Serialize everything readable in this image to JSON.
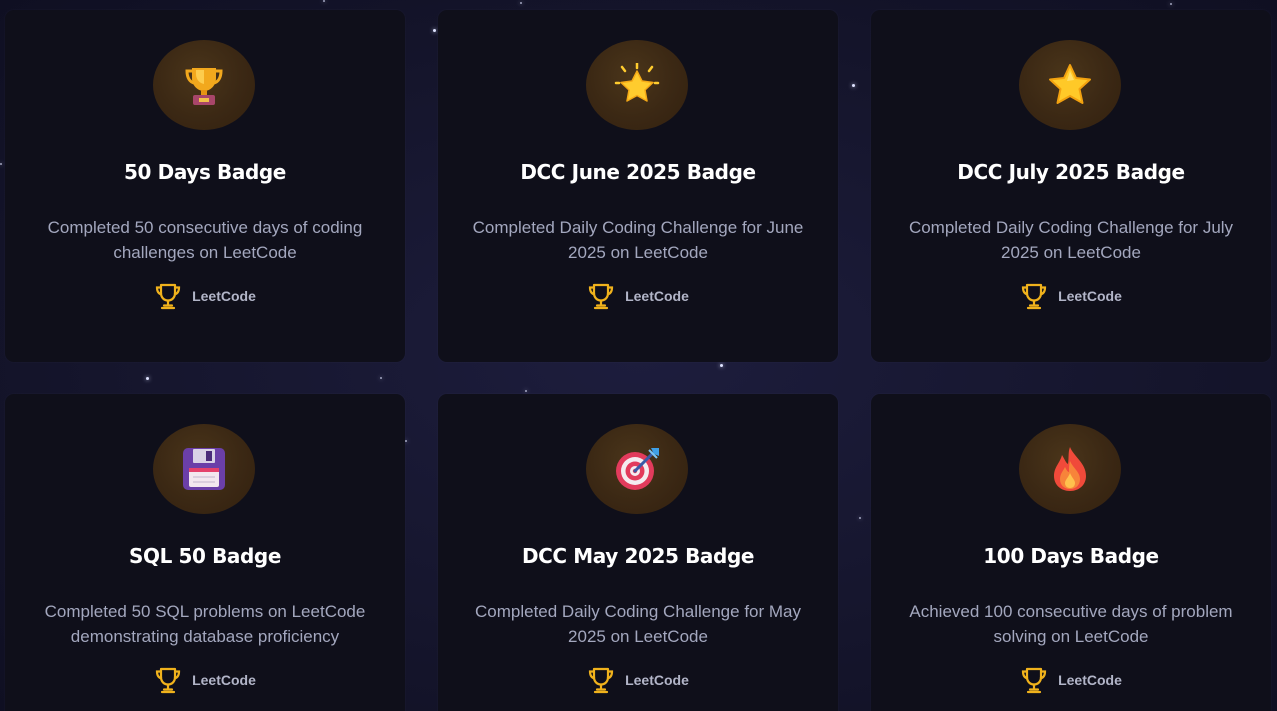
{
  "badges": [
    {
      "icon": "trophy-icon",
      "title": "50 Days Badge",
      "description": "Completed 50 consecutive days of coding challenges on LeetCode",
      "source": "LeetCode"
    },
    {
      "icon": "glowing-star-icon",
      "title": "DCC June 2025 Badge",
      "description": "Completed Daily Coding Challenge for June 2025 on LeetCode",
      "source": "LeetCode"
    },
    {
      "icon": "star-icon",
      "title": "DCC July 2025 Badge",
      "description": "Completed Daily Coding Challenge for July 2025 on LeetCode",
      "source": "LeetCode"
    },
    {
      "icon": "floppy-disk-icon",
      "title": "SQL 50 Badge",
      "description": "Completed 50 SQL problems on LeetCode demonstrating database proficiency",
      "source": "LeetCode"
    },
    {
      "icon": "bullseye-icon",
      "title": "DCC May 2025 Badge",
      "description": "Completed Daily Coding Challenge for May 2025 on LeetCode",
      "source": "LeetCode"
    },
    {
      "icon": "fire-icon",
      "title": "100 Days Badge",
      "description": "Achieved 100 consecutive days of problem solving on LeetCode",
      "source": "LeetCode"
    }
  ],
  "colors": {
    "background": "#15152c",
    "card": "#0f0f1a",
    "accent_gold": "#f0b21c",
    "title": "#ffffff",
    "description": "#a3a7be"
  }
}
